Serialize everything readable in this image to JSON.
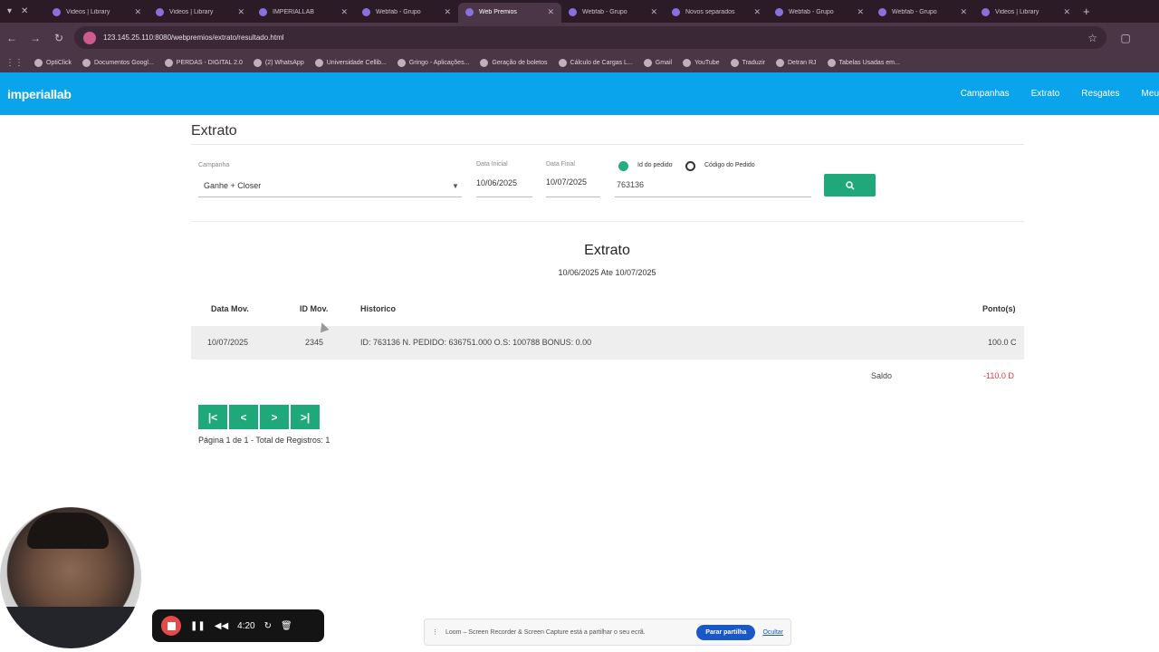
{
  "browser": {
    "tabs": [
      {
        "label": "Videos | Library",
        "active": false
      },
      {
        "label": "Videos | Library",
        "active": false
      },
      {
        "label": "IMPERIALLAB",
        "active": false
      },
      {
        "label": "Webfab - Grupo",
        "active": false
      },
      {
        "label": "Web Premios",
        "active": true
      },
      {
        "label": "Webfab - Grupo",
        "active": false
      },
      {
        "label": "Novos separados",
        "active": false
      },
      {
        "label": "Webfab - Grupo",
        "active": false
      },
      {
        "label": "Webfab - Grupo",
        "active": false
      },
      {
        "label": "Videos | Library",
        "active": false
      }
    ],
    "url": "123.145.25.110:8080/webpremios/extrato/resultado.html",
    "bookmarks": [
      "OptiClick",
      "Documentos Googl...",
      "PERDAS - DIGITAL 2.0",
      "(2) WhatsApp",
      "Universidade Cellib...",
      "Gringo - Aplicações...",
      "Geração de boletos",
      "Cálculo de Cargas L...",
      "Gmail",
      "YouTube",
      "Traduzir",
      "Detran RJ",
      "Tabelas Usadas em..."
    ]
  },
  "app": {
    "brand": "imperiallab",
    "nav": [
      "Campanhas",
      "Extrato",
      "Resgates",
      "Meu"
    ]
  },
  "filters": {
    "page_title": "Extrato",
    "campaign_label": "Campanha",
    "campaign_value": "Ganhe + Closer",
    "start_label": "Data Inicial",
    "start_value": "10/06/2025",
    "end_label": "Data Final",
    "end_value": "10/07/2025",
    "radio_order_id": "Id do pedido",
    "radio_order_code": "Código do Pedido",
    "order_value": "763136"
  },
  "report": {
    "title": "Extrato",
    "range": "10/06/2025 Ate 10/07/2025",
    "headers": [
      "Data Mov.",
      "ID Mov.",
      "Historico",
      "Ponto(s)"
    ],
    "rows": [
      {
        "date": "10/07/2025",
        "id": "2345",
        "history": "ID: 763136 N. PEDIDO: 636751.000 O.S: 100788 BONUS: 0.00",
        "points": "100.0 C"
      }
    ],
    "saldo_label": "Saldo",
    "saldo_value": "-110.0 D"
  },
  "pager": {
    "info": "Página 1 de 1 - Total de Registros: 1",
    "first": "|<",
    "prev": "<",
    "next": ">",
    "last": ">|"
  },
  "recorder": {
    "time": "4:20",
    "share_text": "Loom – Screen Recorder & Screen Capture está a partilhar o seu ecrã.",
    "stop_label": "Parar partilha",
    "hide_label": "Ocultar"
  }
}
